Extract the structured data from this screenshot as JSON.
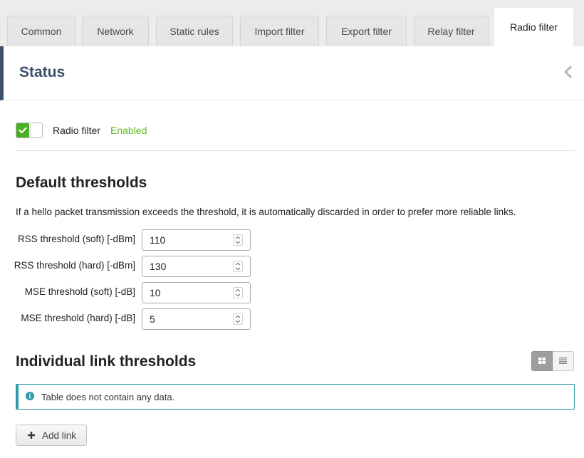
{
  "tabs": [
    {
      "label": "Common",
      "active": false
    },
    {
      "label": "Network",
      "active": false
    },
    {
      "label": "Static rules",
      "active": false
    },
    {
      "label": "Import filter",
      "active": false
    },
    {
      "label": "Export filter",
      "active": false
    },
    {
      "label": "Relay filter",
      "active": false
    },
    {
      "label": "Radio filter",
      "active": true
    }
  ],
  "status": {
    "title": "Status",
    "toggle_label": "Radio filter",
    "toggle_state": "Enabled"
  },
  "default_thresholds": {
    "title": "Default thresholds",
    "description": "If a hello packet transmission exceeds the threshold, it is automatically discarded in order to prefer more reliable links.",
    "fields": [
      {
        "label": "RSS threshold (soft) [-dBm]",
        "value": "110"
      },
      {
        "label": "RSS threshold (hard) [-dBm]",
        "value": "130"
      },
      {
        "label": "MSE threshold (soft) [-dB]",
        "value": "10"
      },
      {
        "label": "MSE threshold (hard) [-dB]",
        "value": "5"
      }
    ]
  },
  "individual": {
    "title": "Individual link thresholds",
    "empty_text": "Table does not contain any data.",
    "add_label": "Add link"
  },
  "colors": {
    "accent": "#3c4f6b",
    "enabled": "#5dbb1f",
    "info": "#2e9aaa"
  }
}
